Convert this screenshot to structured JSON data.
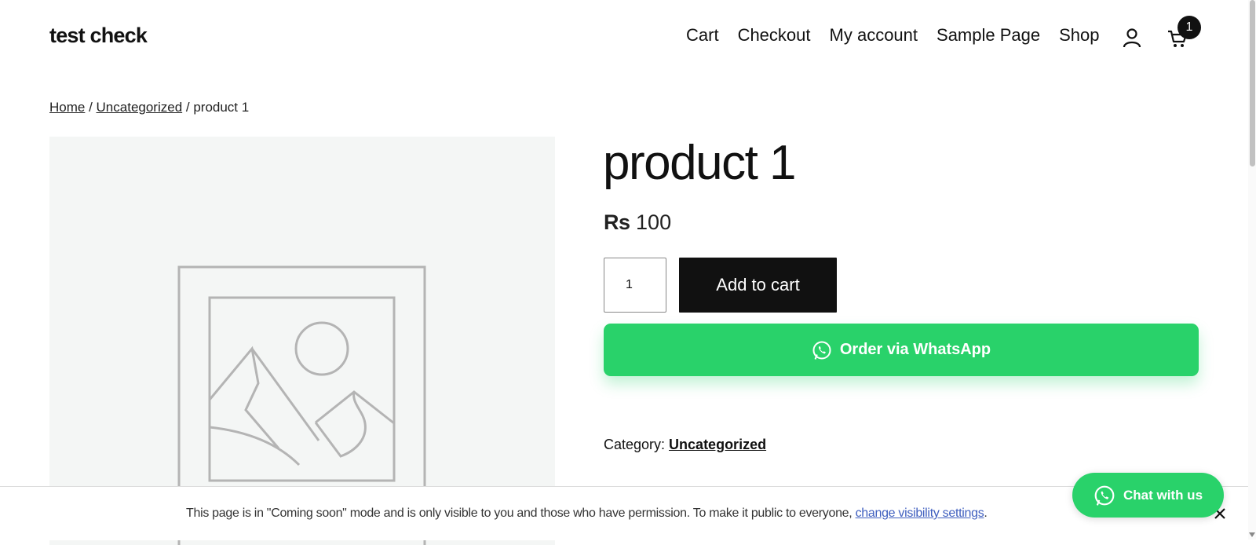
{
  "site": {
    "title": "test check"
  },
  "nav": {
    "items": [
      "Cart",
      "Checkout",
      "My account",
      "Sample Page",
      "Shop"
    ]
  },
  "header": {
    "cart_count": "1",
    "icons": [
      "account-icon",
      "cart-icon"
    ]
  },
  "breadcrumb": {
    "home": "Home",
    "sep1": " / ",
    "category": "Uncategorized",
    "sep2": " / ",
    "current": "product 1"
  },
  "product": {
    "title": "product 1",
    "currency": "Rs",
    "price": "100",
    "quantity": "1",
    "add_to_cart_label": "Add to cart",
    "whatsapp_label": "Order via WhatsApp",
    "category_label": "Category: ",
    "category_value": "Uncategorized"
  },
  "notice": {
    "text": "This page is in \"Coming soon\" mode and is only visible to you and those who have permission. To make it public to everyone, ",
    "link": "change visibility settings",
    "end": "."
  },
  "chat": {
    "label": "Chat with us"
  },
  "colors": {
    "whatsapp_green": "#29d26a",
    "dark": "#111111",
    "link_blue": "#3f5fbf",
    "image_bg": "#f4f6f5"
  }
}
